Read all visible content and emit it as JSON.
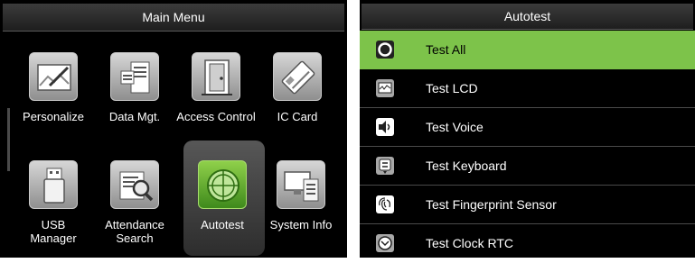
{
  "main_menu": {
    "title": "Main Menu",
    "tiles": [
      {
        "label": "Personalize",
        "icon": "personalize-icon"
      },
      {
        "label": "Data Mgt.",
        "icon": "data-mgt-icon"
      },
      {
        "label": "Access Control",
        "icon": "access-control-icon"
      },
      {
        "label": "IC Card",
        "icon": "ic-card-icon"
      },
      {
        "label": "USB Manager",
        "icon": "usb-manager-icon"
      },
      {
        "label": "Attendance Search",
        "icon": "attendance-search-icon"
      },
      {
        "label": "Autotest",
        "icon": "autotest-icon",
        "selected": true
      },
      {
        "label": "System Info",
        "icon": "system-info-icon"
      }
    ]
  },
  "autotest": {
    "title": "Autotest",
    "items": [
      {
        "label": "Test All",
        "icon": "test-all-icon",
        "selected": true
      },
      {
        "label": "Test LCD",
        "icon": "test-lcd-icon"
      },
      {
        "label": "Test Voice",
        "icon": "test-voice-icon"
      },
      {
        "label": "Test Keyboard",
        "icon": "test-keyboard-icon"
      },
      {
        "label": "Test Fingerprint Sensor",
        "icon": "test-fingerprint-icon"
      },
      {
        "label": "Test Clock RTC",
        "icon": "test-clock-icon"
      }
    ]
  },
  "colors": {
    "accent": "#7dc34a",
    "background": "#000000",
    "active_tile": "#5aa82a"
  }
}
